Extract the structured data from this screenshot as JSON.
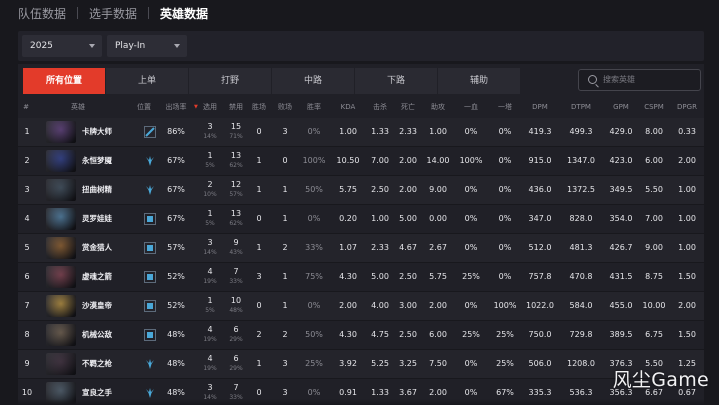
{
  "top_tabs": [
    {
      "label": "队伍数据",
      "active": false
    },
    {
      "label": "选手数据",
      "active": false
    },
    {
      "label": "英雄数据",
      "active": true
    }
  ],
  "filters": {
    "year": "2025",
    "stage": "Play-In"
  },
  "positions": [
    {
      "label": "所有位置",
      "active": true
    },
    {
      "label": "上单",
      "active": false
    },
    {
      "label": "打野",
      "active": false
    },
    {
      "label": "中路",
      "active": false
    },
    {
      "label": "下路",
      "active": false
    },
    {
      "label": "辅助",
      "active": false
    }
  ],
  "search": {
    "placeholder": "搜索英雄"
  },
  "columns": {
    "rank": "#",
    "hero": "英雄",
    "position": "位置",
    "appear": "出场率",
    "pick": "选用",
    "ban": "禁用",
    "win": "胜场",
    "lose": "败场",
    "winrate": "胜率",
    "kda": "KDA",
    "kill": "击杀",
    "death": "死亡",
    "assist": "助攻",
    "fb": "一血",
    "ft": "一塔",
    "dpm": "DPM",
    "dtpm": "DTPM",
    "gpm": "GPM",
    "cspm": "CSPM",
    "dpgr": "DPGR"
  },
  "rows": [
    {
      "rank": "1",
      "hero": "卡牌大师",
      "pos": "mid",
      "appear": "86%",
      "pick": "3",
      "pick_pct": "14%",
      "ban": "15",
      "ban_pct": "71%",
      "win": "0",
      "lose": "3",
      "winrate": "0%",
      "kda": "1.00",
      "kill": "1.33",
      "death": "2.33",
      "assist": "1.00",
      "fb": "0%",
      "ft": "0%",
      "dpm": "419.3",
      "dtpm": "499.3",
      "gpm": "429.0",
      "cspm": "8.00",
      "dpgr": "0.33"
    },
    {
      "rank": "2",
      "hero": "永恒梦魇",
      "pos": "jungle",
      "appear": "67%",
      "pick": "1",
      "pick_pct": "5%",
      "ban": "13",
      "ban_pct": "62%",
      "win": "1",
      "lose": "0",
      "winrate": "100%",
      "kda": "10.50",
      "kill": "7.00",
      "death": "2.00",
      "assist": "14.00",
      "fb": "100%",
      "ft": "0%",
      "dpm": "915.0",
      "dtpm": "1347.0",
      "gpm": "423.0",
      "cspm": "6.00",
      "dpgr": "2.00"
    },
    {
      "rank": "3",
      "hero": "扭曲树精",
      "pos": "jungle",
      "appear": "67%",
      "pick": "2",
      "pick_pct": "10%",
      "ban": "12",
      "ban_pct": "57%",
      "win": "1",
      "lose": "1",
      "winrate": "50%",
      "kda": "5.75",
      "kill": "2.50",
      "death": "2.00",
      "assist": "9.00",
      "fb": "0%",
      "ft": "0%",
      "dpm": "436.0",
      "dtpm": "1372.5",
      "gpm": "349.5",
      "cspm": "5.50",
      "dpgr": "1.00"
    },
    {
      "rank": "4",
      "hero": "灵罗娃娃",
      "pos": "support",
      "appear": "67%",
      "pick": "1",
      "pick_pct": "5%",
      "ban": "13",
      "ban_pct": "62%",
      "win": "0",
      "lose": "1",
      "winrate": "0%",
      "kda": "0.20",
      "kill": "1.00",
      "death": "5.00",
      "assist": "0.00",
      "fb": "0%",
      "ft": "0%",
      "dpm": "347.0",
      "dtpm": "828.0",
      "gpm": "354.0",
      "cspm": "7.00",
      "dpgr": "1.00"
    },
    {
      "rank": "5",
      "hero": "赏金猎人",
      "pos": "support",
      "appear": "57%",
      "pick": "3",
      "pick_pct": "14%",
      "ban": "9",
      "ban_pct": "43%",
      "win": "1",
      "lose": "2",
      "winrate": "33%",
      "kda": "1.07",
      "kill": "2.33",
      "death": "4.67",
      "assist": "2.67",
      "fb": "0%",
      "ft": "0%",
      "dpm": "512.0",
      "dtpm": "481.3",
      "gpm": "426.7",
      "cspm": "9.00",
      "dpgr": "1.00"
    },
    {
      "rank": "6",
      "hero": "虚魂之箭",
      "pos": "support",
      "appear": "52%",
      "pick": "4",
      "pick_pct": "19%",
      "ban": "7",
      "ban_pct": "33%",
      "win": "3",
      "lose": "1",
      "winrate": "75%",
      "kda": "4.30",
      "kill": "5.00",
      "death": "2.50",
      "assist": "5.75",
      "fb": "25%",
      "ft": "0%",
      "dpm": "757.8",
      "dtpm": "470.8",
      "gpm": "431.5",
      "cspm": "8.75",
      "dpgr": "1.50"
    },
    {
      "rank": "7",
      "hero": "沙漠皇帝",
      "pos": "support",
      "appear": "52%",
      "pick": "1",
      "pick_pct": "5%",
      "ban": "10",
      "ban_pct": "48%",
      "win": "0",
      "lose": "1",
      "winrate": "0%",
      "kda": "2.00",
      "kill": "4.00",
      "death": "3.00",
      "assist": "2.00",
      "fb": "0%",
      "ft": "100%",
      "dpm": "1022.0",
      "dtpm": "584.0",
      "gpm": "455.0",
      "cspm": "10.00",
      "dpgr": "2.00"
    },
    {
      "rank": "8",
      "hero": "机械公敌",
      "pos": "support",
      "appear": "48%",
      "pick": "4",
      "pick_pct": "19%",
      "ban": "6",
      "ban_pct": "29%",
      "win": "2",
      "lose": "2",
      "winrate": "50%",
      "kda": "4.30",
      "kill": "4.75",
      "death": "2.50",
      "assist": "6.00",
      "fb": "25%",
      "ft": "25%",
      "dpm": "750.0",
      "dtpm": "729.8",
      "gpm": "389.5",
      "cspm": "6.75",
      "dpgr": "1.50"
    },
    {
      "rank": "9",
      "hero": "不羁之枪",
      "pos": "jungle",
      "appear": "48%",
      "pick": "4",
      "pick_pct": "19%",
      "ban": "6",
      "ban_pct": "29%",
      "win": "1",
      "lose": "3",
      "winrate": "25%",
      "kda": "3.92",
      "kill": "5.25",
      "death": "3.25",
      "assist": "7.50",
      "fb": "0%",
      "ft": "25%",
      "dpm": "506.0",
      "dtpm": "1208.0",
      "gpm": "376.3",
      "cspm": "5.50",
      "dpgr": "1.25"
    },
    {
      "rank": "10",
      "hero": "宣良之手",
      "pos": "jungle",
      "appear": "48%",
      "pick": "3",
      "pick_pct": "14%",
      "ban": "7",
      "ban_pct": "33%",
      "win": "0",
      "lose": "3",
      "winrate": "0%",
      "kda": "0.91",
      "kill": "1.33",
      "death": "3.67",
      "assist": "2.00",
      "fb": "0%",
      "ft": "67%",
      "dpm": "335.3",
      "dtpm": "536.3",
      "gpm": "356.3",
      "cspm": "6.67",
      "dpgr": "0.67"
    }
  ],
  "avatar_colors": [
    "#5a3a7a",
    "#2a3a8a",
    "#3a4a5a",
    "#4a7aa0",
    "#8a5a2a",
    "#7a3a4a",
    "#b08a3a",
    "#6a5a4a",
    "#3a2a3a",
    "#4a5a6a"
  ],
  "colors": {
    "accent": "#e33b2a",
    "pos_icon": "#4aa8d8"
  },
  "watermark": "风尘Game"
}
